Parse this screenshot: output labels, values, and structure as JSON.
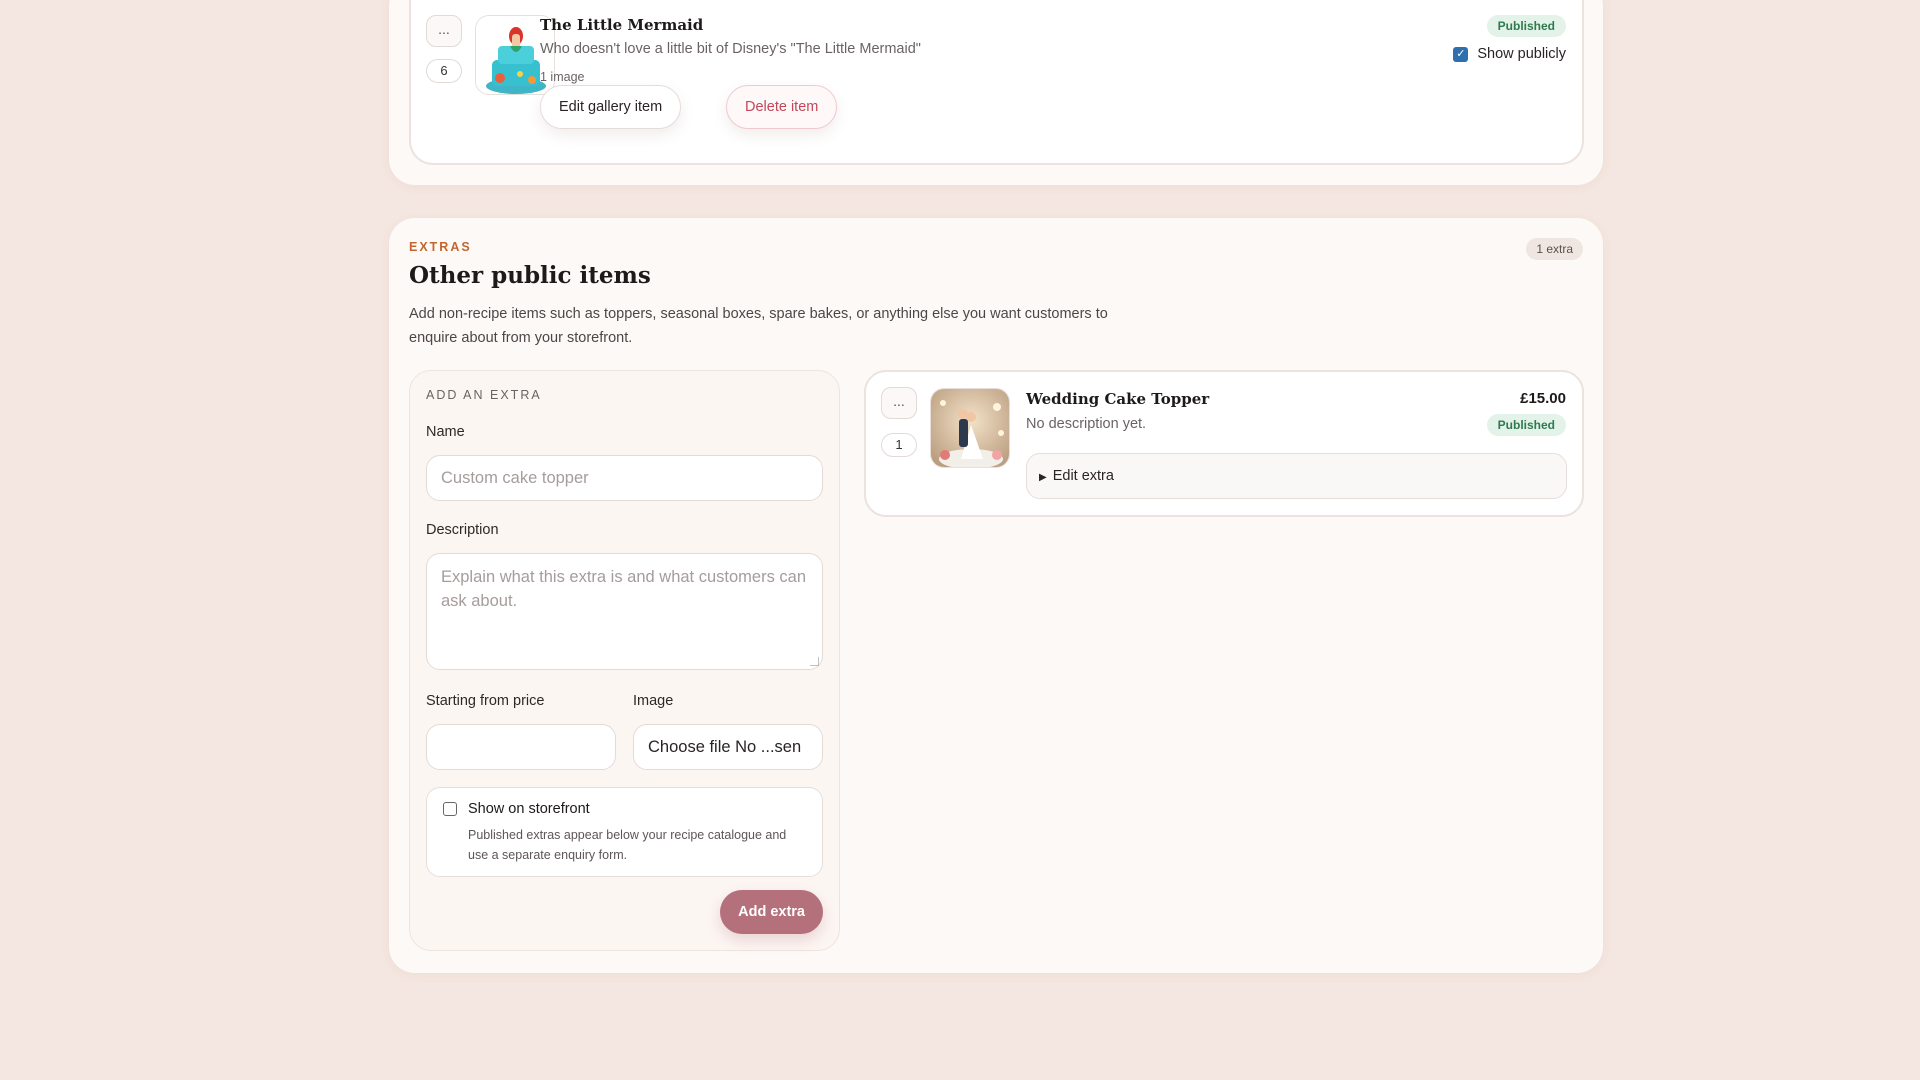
{
  "gallery": {
    "item": {
      "reorder_label": "...",
      "position": "6",
      "title": "The Little Mermaid",
      "description": "Who doesn't love a little bit of Disney's \"The Little Mermaid\"",
      "meta": "1 image",
      "status": "Published",
      "show_publicly_label": "Show publicly",
      "show_publicly_checked": true,
      "edit_label": "Edit gallery item",
      "delete_label": "Delete item"
    }
  },
  "extras": {
    "eyebrow": "EXTRAS",
    "count": "1 extra",
    "title": "Other public items",
    "description": "Add non-recipe items such as toppers, seasonal boxes, spare bakes, or anything else you want customers to enquire about from your storefront.",
    "form": {
      "eyebrow": "ADD AN EXTRA",
      "name_label": "Name",
      "name_placeholder": "Custom cake topper",
      "description_label": "Description",
      "description_placeholder": "Explain what this extra is and what customers can ask about.",
      "price_label": "Starting from price",
      "price_value": "",
      "image_label": "Image",
      "file_label": "Choose file No ...sen",
      "storefront_label": "Show on storefront",
      "storefront_help": "Published extras appear below your recipe catalogue and use a separate enquiry form.",
      "storefront_checked": false,
      "submit_label": "Add extra"
    },
    "items": [
      {
        "reorder_label": "...",
        "position": "1",
        "title": "Wedding Cake Topper",
        "description": "No description yet.",
        "price": "£15.00",
        "status": "Published",
        "edit_label": "Edit extra"
      }
    ]
  },
  "colors": {
    "accent": "#b4707b",
    "eyebrow": "#c2672f",
    "published_bg": "#e3f3ea",
    "published_text": "#2f7a4f",
    "danger": "#c2475a",
    "page_bg": "#f4e6e0"
  },
  "icons": [
    "ellipsis-icon",
    "checkbox-checked-icon",
    "disclosure-triangle-icon"
  ]
}
